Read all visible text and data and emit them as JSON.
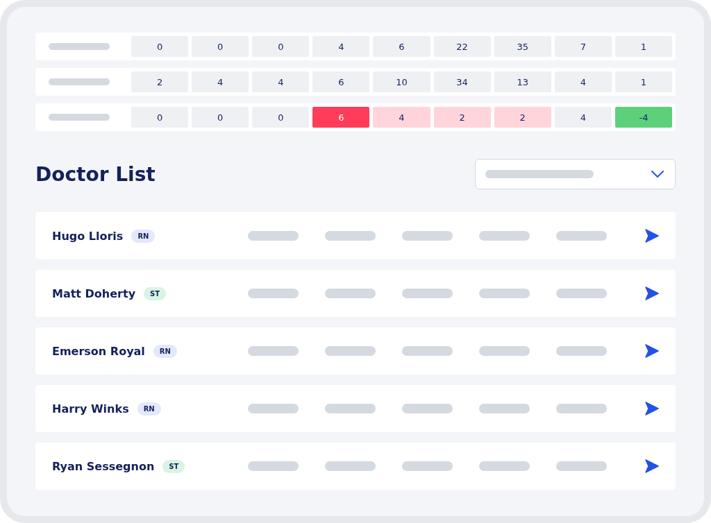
{
  "summary_rows": [
    {
      "cells": [
        {
          "value": "0",
          "kind": "neutral"
        },
        {
          "value": "0",
          "kind": "neutral"
        },
        {
          "value": "0",
          "kind": "neutral"
        },
        {
          "value": "4",
          "kind": "neutral"
        },
        {
          "value": "6",
          "kind": "neutral"
        },
        {
          "value": "22",
          "kind": "neutral"
        },
        {
          "value": "35",
          "kind": "neutral"
        },
        {
          "value": "7",
          "kind": "neutral"
        },
        {
          "value": "1",
          "kind": "neutral"
        }
      ]
    },
    {
      "cells": [
        {
          "value": "2",
          "kind": "neutral"
        },
        {
          "value": "4",
          "kind": "neutral"
        },
        {
          "value": "4",
          "kind": "neutral"
        },
        {
          "value": "6",
          "kind": "neutral"
        },
        {
          "value": "10",
          "kind": "neutral"
        },
        {
          "value": "34",
          "kind": "neutral"
        },
        {
          "value": "13",
          "kind": "neutral"
        },
        {
          "value": "4",
          "kind": "neutral"
        },
        {
          "value": "1",
          "kind": "neutral"
        }
      ]
    },
    {
      "cells": [
        {
          "value": "0",
          "kind": "neutral"
        },
        {
          "value": "0",
          "kind": "neutral"
        },
        {
          "value": "0",
          "kind": "neutral"
        },
        {
          "value": "6",
          "kind": "alert"
        },
        {
          "value": "4",
          "kind": "warning"
        },
        {
          "value": "2",
          "kind": "warning"
        },
        {
          "value": "2",
          "kind": "warning"
        },
        {
          "value": "4",
          "kind": "neutral"
        },
        {
          "value": "-4",
          "kind": "positive"
        }
      ]
    }
  ],
  "doctor_list": {
    "title": "Doctor List",
    "doctors": [
      {
        "name": "Hugo Lloris",
        "badge": "RN",
        "color": "#e3e9fb"
      },
      {
        "name": "Matt Doherty",
        "badge": "ST",
        "color": "#d9f3e4"
      },
      {
        "name": "Emerson Royal",
        "badge": "RN",
        "color": "#e3e9fb"
      },
      {
        "name": "Harry Winks",
        "badge": "RN",
        "color": "#e3e9fb"
      },
      {
        "name": "Ryan Sessegnon",
        "badge": "ST",
        "color": "#d9f3e4"
      }
    ]
  }
}
